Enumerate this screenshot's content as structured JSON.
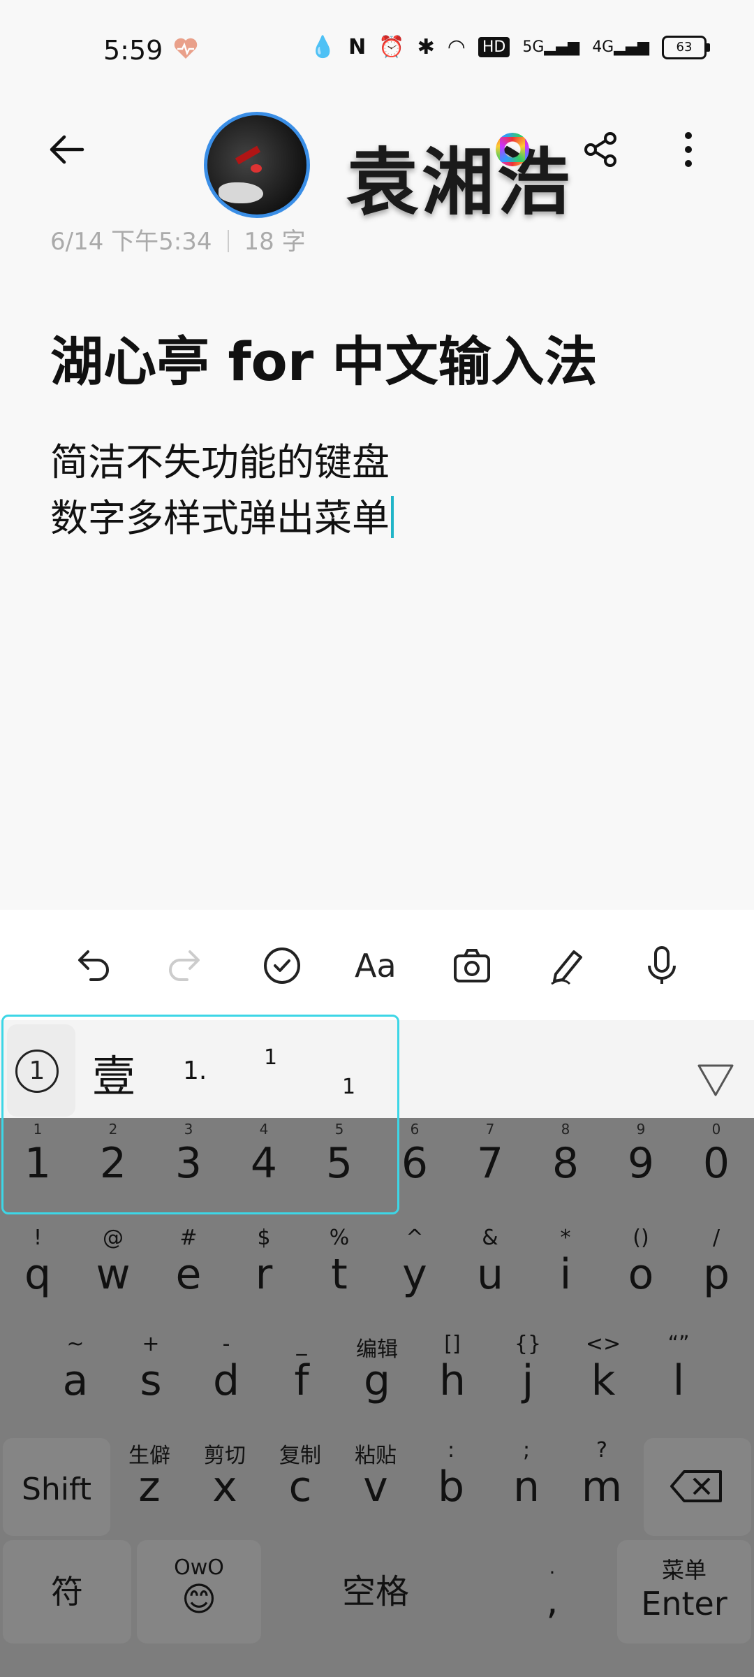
{
  "status": {
    "time": "5:59",
    "hd_label": "HD",
    "net1": "5G",
    "net2": "4G",
    "battery": "63"
  },
  "header": {
    "brand_text": "袁湘浩",
    "meta_date": "6/14 下午5:34",
    "meta_count": "18 字"
  },
  "note": {
    "title": "湖心亭 for 中文输入法",
    "line1": "简洁不失功能的键盘",
    "line2": "数字多样式弹出菜单"
  },
  "suggestions": {
    "s1": "壹",
    "s2": "1.",
    "s3": "1",
    "s4": "1"
  },
  "keyboard": {
    "num_row": [
      {
        "hint": "1",
        "key": "1"
      },
      {
        "hint": "2",
        "key": "2"
      },
      {
        "hint": "3",
        "key": "3"
      },
      {
        "hint": "4",
        "key": "4"
      },
      {
        "hint": "5",
        "key": "5"
      },
      {
        "hint": "6",
        "key": "6"
      },
      {
        "hint": "7",
        "key": "7"
      },
      {
        "hint": "8",
        "key": "8"
      },
      {
        "hint": "9",
        "key": "9"
      },
      {
        "hint": "0",
        "key": "0"
      }
    ],
    "row1": [
      {
        "sym": "!",
        "key": "q"
      },
      {
        "sym": "@",
        "key": "w"
      },
      {
        "sym": "#",
        "key": "e"
      },
      {
        "sym": "$",
        "key": "r"
      },
      {
        "sym": "%",
        "key": "t"
      },
      {
        "sym": "^",
        "key": "y"
      },
      {
        "sym": "&",
        "key": "u"
      },
      {
        "sym": "*",
        "key": "i"
      },
      {
        "sym": "()",
        "key": "o"
      },
      {
        "sym": "/",
        "key": "p"
      }
    ],
    "row2": [
      {
        "sym": "~",
        "key": "a"
      },
      {
        "sym": "+",
        "key": "s"
      },
      {
        "sym": "-",
        "key": "d"
      },
      {
        "sym": "_",
        "key": "f"
      },
      {
        "sym": "编辑",
        "key": "g"
      },
      {
        "sym": "[]",
        "key": "h"
      },
      {
        "sym": "{}",
        "key": "j"
      },
      {
        "sym": "<>",
        "key": "k"
      },
      {
        "sym": "“”",
        "key": "l"
      }
    ],
    "row3": [
      {
        "sym": "生僻",
        "key": "z"
      },
      {
        "sym": "剪切",
        "key": "x"
      },
      {
        "sym": "复制",
        "key": "c"
      },
      {
        "sym": "粘贴",
        "key": "v"
      },
      {
        "sym": ":",
        "key": "b"
      },
      {
        "sym": ";",
        "key": "n"
      },
      {
        "sym": "?",
        "key": "m"
      }
    ],
    "shift": "Shift",
    "fu": "符",
    "owo": "OwO",
    "emoji": "😊",
    "space": "空格",
    "comma_top": ".",
    "comma": ",",
    "menu": "菜单",
    "enter": "Enter"
  }
}
